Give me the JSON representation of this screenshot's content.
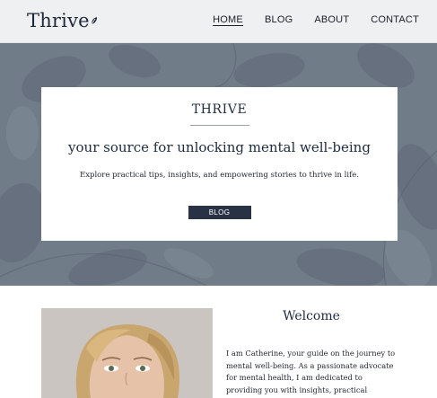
{
  "header": {
    "logo_text": "Thrive",
    "logo_icon": "leaf-icon",
    "nav": [
      {
        "label": "HOME",
        "active": true
      },
      {
        "label": "BLOG",
        "active": false
      },
      {
        "label": "ABOUT",
        "active": false
      },
      {
        "label": "CONTACT",
        "active": false
      }
    ]
  },
  "hero": {
    "title": "THRIVE",
    "subtitle": "your source for unlocking mental well-being",
    "description": "Explore practical tips, insights, and empowering stories to thrive in life.",
    "button_label": "BLOG"
  },
  "about": {
    "heading": "Welcome",
    "bio": "I am Catherine, your guide on the journey to mental well-being. As a passionate advocate for mental health, I am dedicated to providing you with insights, practical strategies, and inspiring"
  },
  "colors": {
    "hero_bg": "#6f7a87",
    "button_bg": "#283244",
    "topbar_bg": "#eef0f2"
  }
}
